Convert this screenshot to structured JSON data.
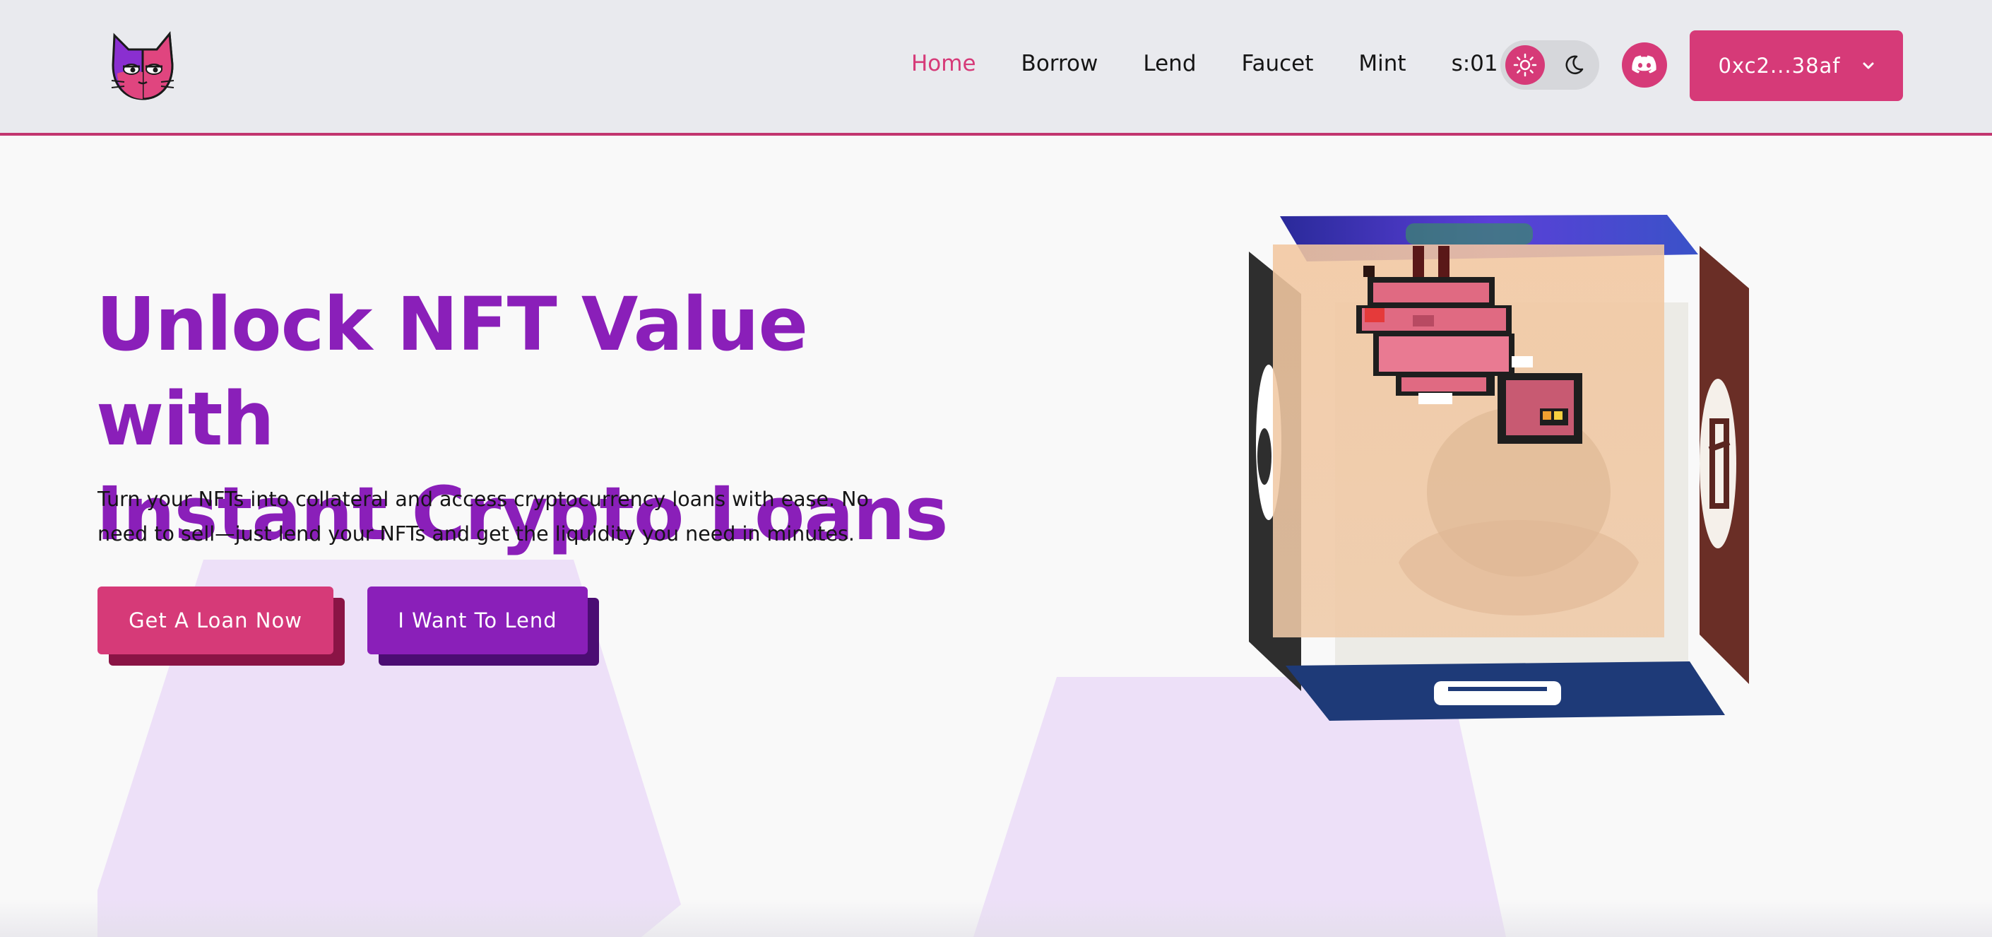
{
  "header": {
    "logo_icon": "cat-mask-logo",
    "nav": [
      {
        "label": "Home",
        "active": true
      },
      {
        "label": "Borrow",
        "active": false
      },
      {
        "label": "Lend",
        "active": false
      },
      {
        "label": "Faucet",
        "active": false
      },
      {
        "label": "Mint",
        "active": false
      },
      {
        "label": "s:01",
        "active": false
      }
    ],
    "theme_toggle": {
      "options": [
        "sun-icon",
        "moon-icon"
      ],
      "selected": "light"
    },
    "discord_icon": "discord-icon",
    "wallet": {
      "address": "0xc2...38af",
      "icon": "chevron-down-icon"
    }
  },
  "hero": {
    "title_line1": "Unlock NFT Value with",
    "title_line2": "Instant Crypto Loans",
    "subtitle": "Turn your NFTs into collateral and access cryptocurrency loans with ease. No need to sell—just lend your NFTs and get the liquidity you need in minutes.",
    "primary_button": "Get A Loan Now",
    "secondary_button": "I Want To Lend"
  },
  "colors": {
    "accent_pink": "#d63a78",
    "accent_purple": "#8a1fb9",
    "header_bg": "#e9eaee",
    "page_bg": "#f9f9f9",
    "shape_lavender": "#ede0f8"
  },
  "showcase": {
    "type": "rotating-nft-cube",
    "icon": "nft-cube-illustration"
  }
}
